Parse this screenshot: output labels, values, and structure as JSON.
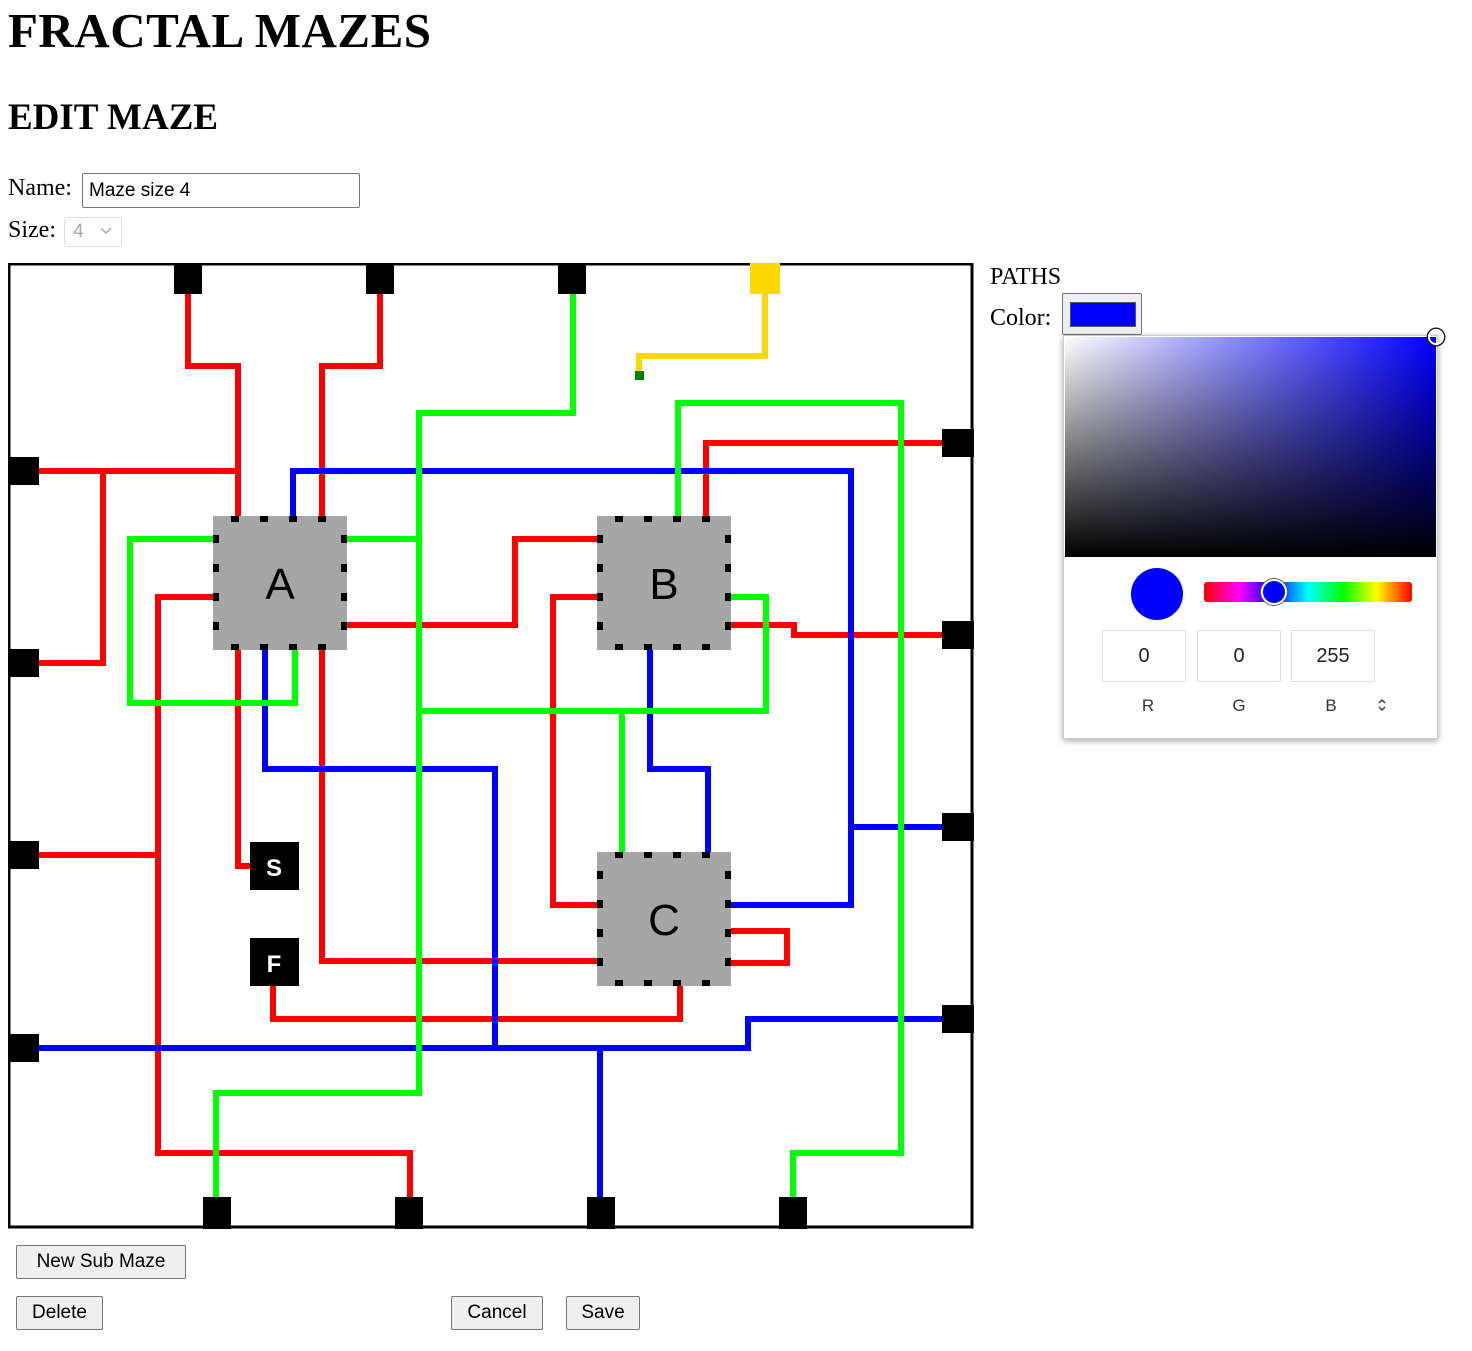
{
  "page": {
    "title": "FRACTAL MAZES",
    "subtitle": "EDIT MAZE"
  },
  "form": {
    "name_label": "Name:",
    "name_value": "Maze size 4",
    "size_label": "Size:",
    "size_value": "4"
  },
  "maze": {
    "blocks": [
      "A",
      "B",
      "C"
    ],
    "start_label": "S",
    "finish_label": "F",
    "path_colors": {
      "red": "#ff0000",
      "blue": "#0000ff",
      "green": "#00ff00",
      "yellow": "#ffd700"
    }
  },
  "paths_panel": {
    "heading": "PATHS",
    "color_label": "Color:",
    "current_color": "#0000ff"
  },
  "color_picker": {
    "hue_color": "#0000ff",
    "r": "0",
    "g": "0",
    "b": "255",
    "r_label": "R",
    "g_label": "G",
    "b_label": "B",
    "mode_toggle_icon": "up-down-chevron-icon"
  },
  "buttons": {
    "new_sub_maze": "New Sub Maze",
    "delete": "Delete",
    "cancel": "Cancel",
    "save": "Save"
  }
}
